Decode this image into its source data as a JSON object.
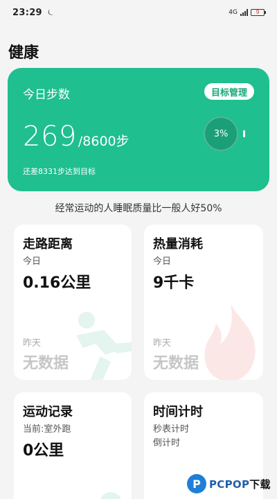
{
  "status": {
    "time": "23:29",
    "network": "4G",
    "battery": "9"
  },
  "page": {
    "title": "健康"
  },
  "steps_card": {
    "title": "今日步数",
    "goal_button": "目标管理",
    "count": "269",
    "target": "/8600步",
    "remain": "还差8331步达到目标",
    "progress_label": "3%",
    "progress": 0.03,
    "bg_color": "#1fbf8f"
  },
  "tip": "经常运动的人睡眠质量比一般人好50%",
  "cards": {
    "distance": {
      "title": "走路距离",
      "today_label": "今日",
      "today_value": "0.16公里",
      "yesterday_label": "昨天",
      "yesterday_value": "无数据"
    },
    "calories": {
      "title": "热量消耗",
      "today_label": "今日",
      "today_value": "9千卡",
      "yesterday_label": "昨天",
      "yesterday_value": "无数据"
    },
    "workout": {
      "title": "运动记录",
      "sub": "当前:室外跑",
      "value": "0公里"
    },
    "timer": {
      "title": "时间计时",
      "stopwatch": "秒表计时",
      "countdown": "倒计时"
    }
  },
  "brand": {
    "logo": "P",
    "name_prefix": "PCPOP",
    "name_suffix": "下载"
  }
}
